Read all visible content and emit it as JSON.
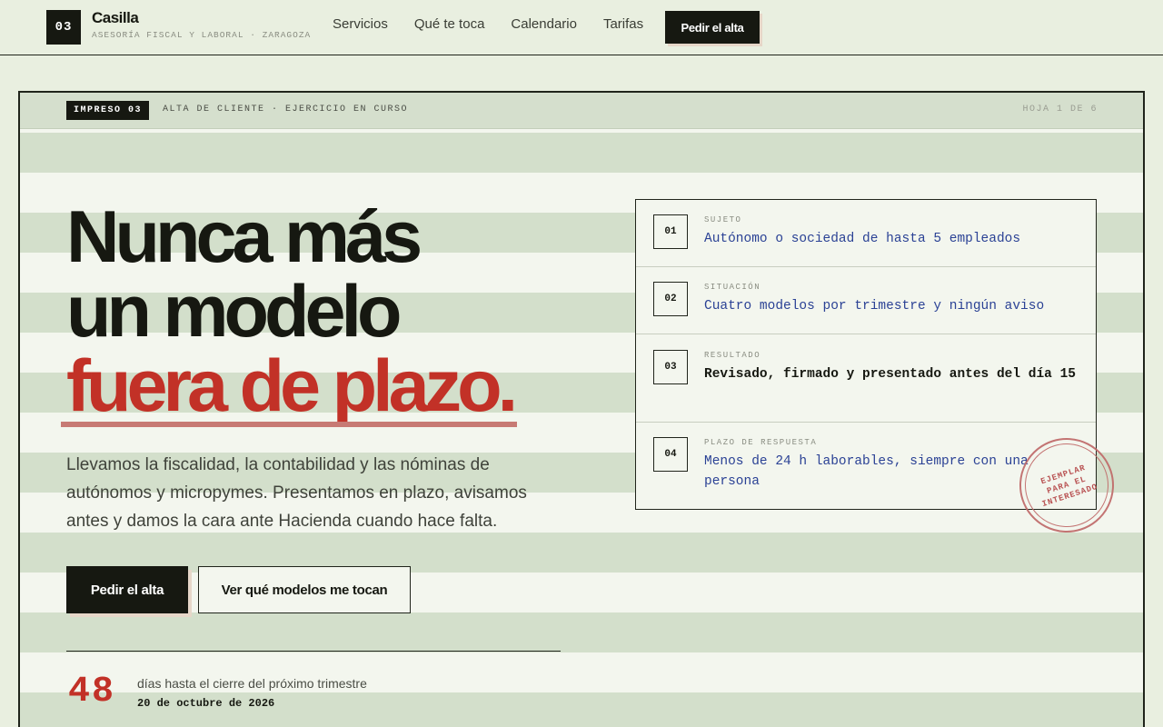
{
  "nav": {
    "logo_number": "03",
    "brand_name": "Casilla",
    "tagline": "ASESORÍA FISCAL Y LABORAL · ZARAGOZA",
    "links": [
      "Servicios",
      "Qué te toca",
      "Calendario",
      "Tarifas"
    ],
    "cta_label": "Pedir el alta"
  },
  "sheet": {
    "form_tag": "IMPRESO 03",
    "form_title": "ALTA DE CLIENTE · EJERCICIO EN CURSO",
    "page_indicator": "HOJA 1 DE 6"
  },
  "hero": {
    "headline_line1": "Nunca más",
    "headline_line2": "un modelo",
    "headline_accent": "fuera de plazo.",
    "lede": "Llevamos la fiscalidad, la contabilidad y las nóminas de autónomos y micropymes. Presentamos en plazo, avisamos antes y damos la cara ante Hacienda cuando hace falta.",
    "primary_button": "Pedir el alta",
    "secondary_button": "Ver qué modelos me tocan"
  },
  "countdown": {
    "number": "48",
    "label": "días hasta el cierre del próximo trimestre",
    "date": "20 de octubre de 2026"
  },
  "card": {
    "rows": [
      {
        "num": "01",
        "label": "SUJETO",
        "text": "Autónomo o sociedad de hasta 5 empleados"
      },
      {
        "num": "02",
        "label": "SITUACIÓN",
        "text": "Cuatro modelos por trimestre y ningún aviso"
      },
      {
        "num": "03",
        "label": "RESULTADO",
        "text": "Revisado, firmado y presentado antes del día 15"
      },
      {
        "num": "04",
        "label": "PLAZO DE RESPUESTA",
        "text": "Menos de 24 h laborables, siempre con una persona"
      }
    ]
  },
  "stamp": {
    "text": "EJEMPLAR PARA EL INTERESADO"
  },
  "colors": {
    "accent_red": "#c23127",
    "ink": "#161811",
    "link_blue": "#2b4295",
    "background": "#e9efe0"
  }
}
